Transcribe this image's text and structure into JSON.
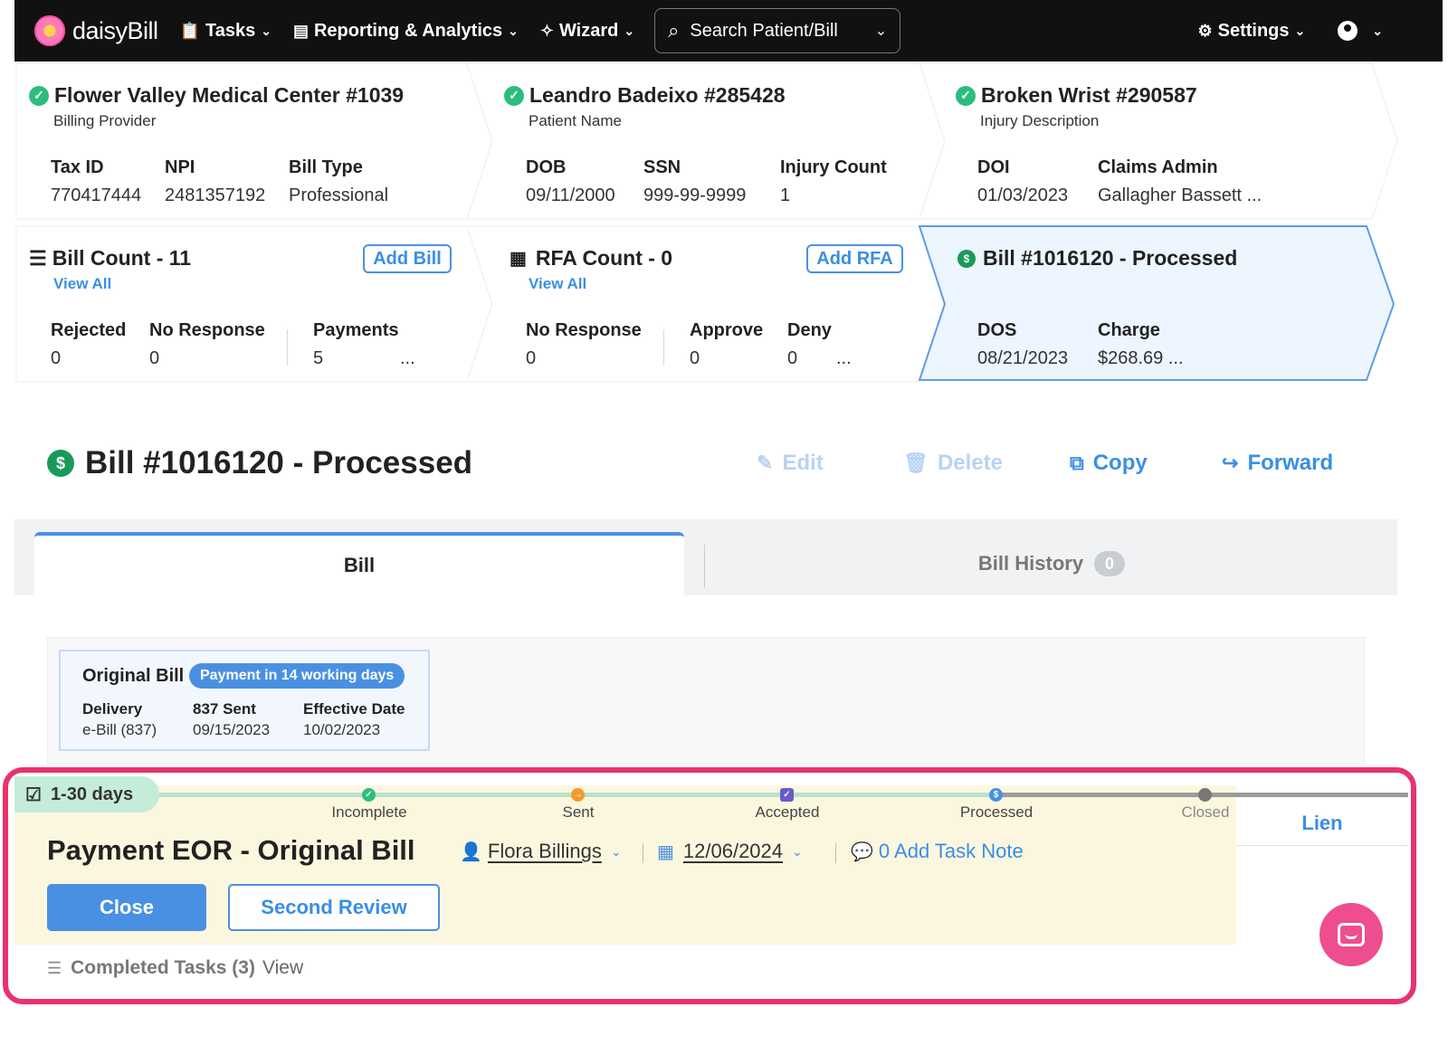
{
  "nav": {
    "logo": "daisyBill",
    "tasks": "Tasks",
    "reporting": "Reporting & Analytics",
    "wizard": "Wizard",
    "search_placeholder": "Search Patient/Bill",
    "settings": "Settings"
  },
  "provider": {
    "title": "Flower Valley Medical Center #1039",
    "subtitle": "Billing Provider",
    "fields": [
      {
        "label": "Tax ID",
        "value": "770417444"
      },
      {
        "label": "NPI",
        "value": "2481357192"
      },
      {
        "label": "Bill Type",
        "value": "Professional"
      }
    ]
  },
  "patient": {
    "title": "Leandro Badeixo #285428",
    "subtitle": "Patient Name",
    "fields": [
      {
        "label": "DOB",
        "value": "09/11/2000"
      },
      {
        "label": "SSN",
        "value": "999-99-9999"
      },
      {
        "label": "Injury Count",
        "value": "1"
      }
    ]
  },
  "injury": {
    "title": "Broken Wrist #290587",
    "subtitle": "Injury Description",
    "fields": [
      {
        "label": "DOI",
        "value": "01/03/2023"
      },
      {
        "label": "Claims Admin",
        "value": "Gallagher Bassett ..."
      }
    ]
  },
  "bill_count": {
    "title": "Bill Count - 11",
    "view_all": "View All",
    "add_button": "Add Bill",
    "fields": [
      {
        "label": "Rejected",
        "value": "0"
      },
      {
        "label": "No Response",
        "value": "0"
      },
      {
        "label": "Payments",
        "value": "5"
      }
    ],
    "more": "..."
  },
  "rfa_count": {
    "title": "RFA Count - 0",
    "view_all": "View All",
    "add_button": "Add RFA",
    "fields": [
      {
        "label": "No Response",
        "value": "0"
      },
      {
        "label": "Approve",
        "value": "0"
      },
      {
        "label": "Deny",
        "value": "0"
      }
    ],
    "more": "..."
  },
  "selected_bill": {
    "title": "Bill #1016120 - Processed",
    "fields": [
      {
        "label": "DOS",
        "value": "08/21/2023"
      },
      {
        "label": "Charge",
        "value": "$268.69 ..."
      }
    ]
  },
  "bill_header": {
    "title": "Bill #1016120 - Processed",
    "actions": {
      "edit": "Edit",
      "delete": "Delete",
      "copy": "Copy",
      "forward": "Forward"
    }
  },
  "tabs": {
    "bill": "Bill",
    "history": "Bill History",
    "history_count": "0"
  },
  "original_bill": {
    "title": "Original Bill",
    "badge": "Payment in 14 working days",
    "fields": [
      {
        "label": "Delivery",
        "value": "e-Bill (837)"
      },
      {
        "label": "837 Sent",
        "value": "09/15/2023"
      },
      {
        "label": "Effective Date",
        "value": "10/02/2023"
      }
    ]
  },
  "task": {
    "age": "1-30 days",
    "steps": [
      "Incomplete",
      "Sent",
      "Accepted",
      "Processed",
      "Closed"
    ],
    "title": "Payment EOR - Original Bill",
    "assignee": "Flora Billings",
    "due_date": "12/06/2024",
    "note_link": "0 Add Task Note",
    "close_button": "Close",
    "review_button": "Second Review",
    "side_tab": "Lien",
    "completed_label": "Completed Tasks (3)",
    "completed_view": "View"
  },
  "colors": {
    "accent": "#4a90e2",
    "success": "#2bbd7e",
    "highlight": "#e8336b",
    "task_bg": "#fbf7df"
  }
}
